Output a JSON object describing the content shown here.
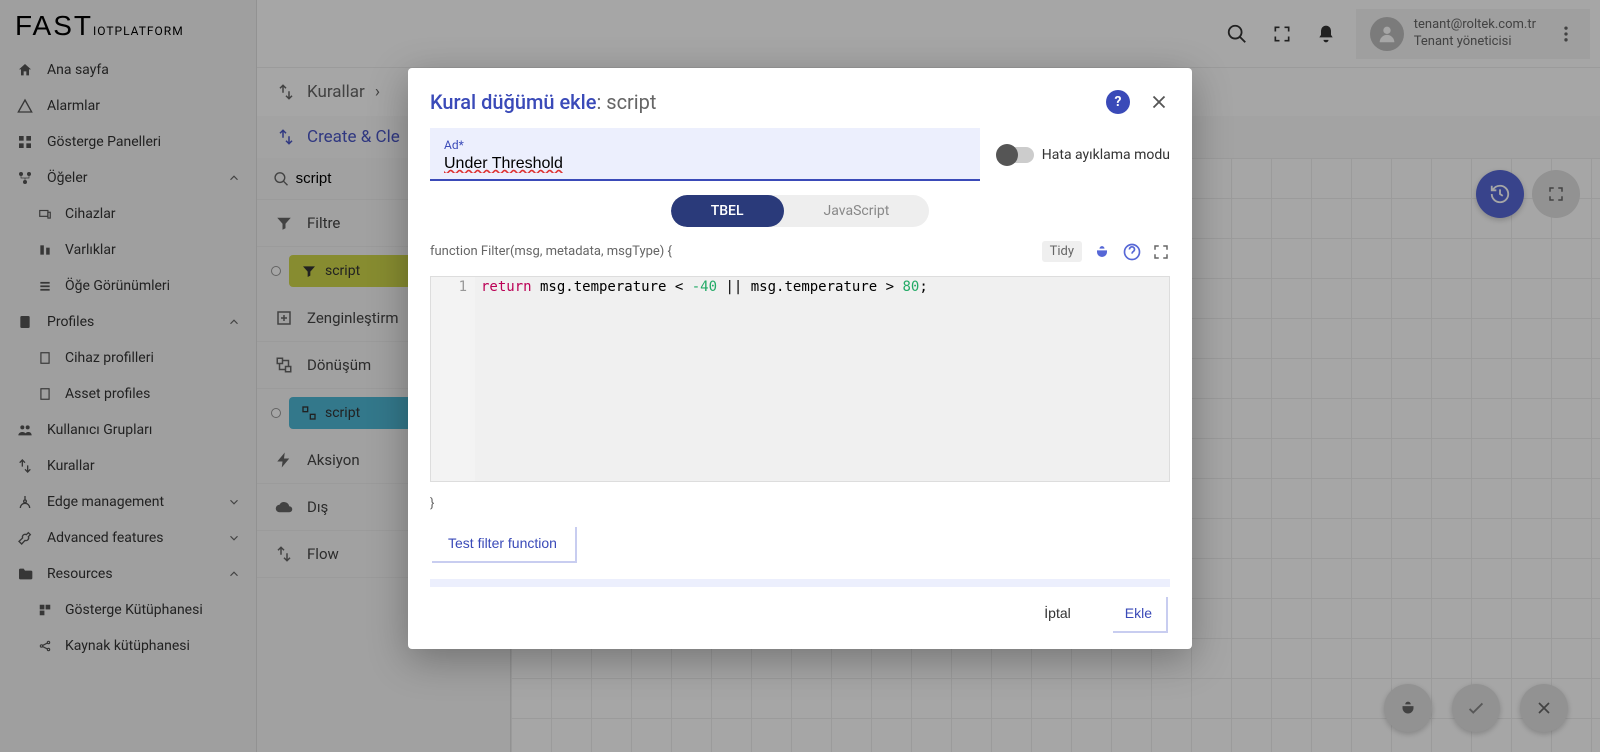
{
  "logo": {
    "main": "FAST",
    "sub": "IOTPLATFORM"
  },
  "sidebar": {
    "home": "Ana sayfa",
    "alarms": "Alarmlar",
    "dashboards": "Gösterge Panelleri",
    "entities": "Öğeler",
    "devices": "Cihazlar",
    "assets": "Varlıklar",
    "views": "Öğe Görünümleri",
    "profiles": "Profiles",
    "device_profiles": "Cihaz profilleri",
    "asset_profiles": "Asset profiles",
    "user_groups": "Kullanıcı Grupları",
    "rules": "Kurallar",
    "edge": "Edge management",
    "advanced": "Advanced features",
    "resources": "Resources",
    "widget_lib": "Gösterge Kütüphanesi",
    "resource_lib": "Kaynak kütüphanesi"
  },
  "topbar": {
    "email": "tenant@roltek.com.tr",
    "role": "Tenant yöneticisi"
  },
  "breadcrumb": {
    "rules": "Kurallar",
    "sep": "›"
  },
  "rule_title": "Create & Cle",
  "node_panel": {
    "search": "script",
    "filter": "Filtre",
    "filter_script": "script",
    "enrich": "Zenginleştirm",
    "transform": "Dönüşüm",
    "transform_script": "script",
    "action": "Aksiyon",
    "external": "Dış",
    "flow": "Flow"
  },
  "modal": {
    "title": "Kural düğümü ekle",
    "subtitle": ": script",
    "name_label": "Ad*",
    "name_value": "Under Threshold",
    "debug_label": "Hata ayıklama modu",
    "tab_tbel": "TBEL",
    "tab_js": "JavaScript",
    "func_sig": "function Filter(msg, metadata, msgType) {",
    "tidy": "Tidy",
    "line_no": "1",
    "code_kw": "return",
    "code_rest_1": " msg.temperature < ",
    "code_num1": "-40",
    "code_mid": " || msg.temperature > ",
    "code_num2": "80",
    "code_end": ";",
    "close_brace": "}",
    "test_btn": "Test filter function",
    "cancel": "İptal",
    "ok": "Ekle"
  }
}
